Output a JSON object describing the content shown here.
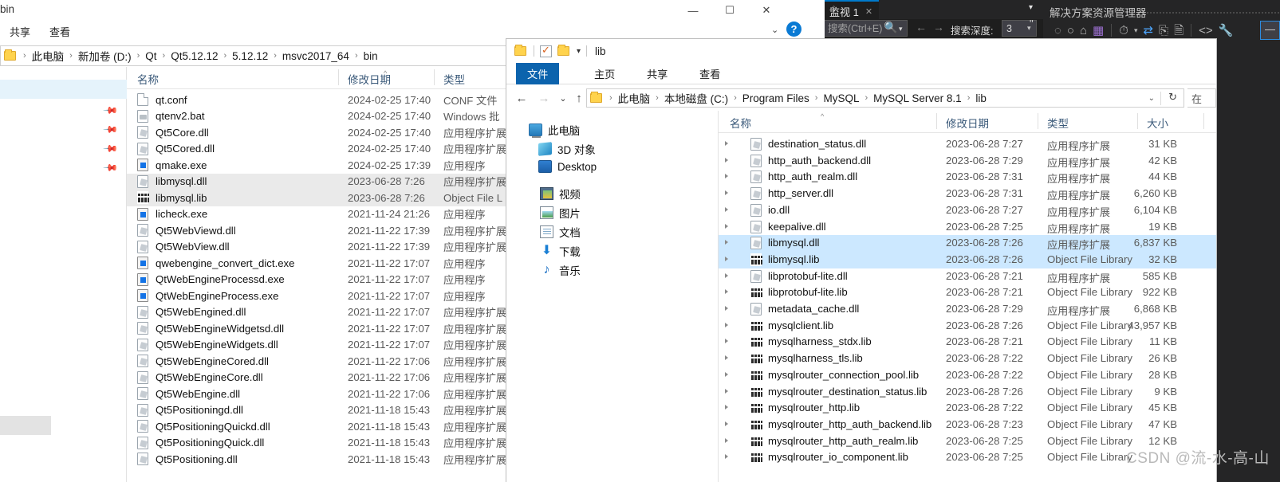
{
  "left_window": {
    "title": "bin",
    "ribbon_tabs": [
      "共享",
      "查看"
    ],
    "window_buttons": {
      "minimize": "—",
      "maximize": "☐",
      "close": "✕"
    },
    "help_label": "?",
    "address_caret": "⌄",
    "breadcrumb": [
      "此电脑",
      "新加卷 (D:)",
      "Qt",
      "Qt5.12.12",
      "5.12.12",
      "msvc2017_64",
      "bin"
    ],
    "columns": [
      "名称",
      "修改日期",
      "类型"
    ],
    "rows": [
      {
        "name": "qt.conf",
        "date": "2024-02-25 17:40",
        "type": "CONF 文件",
        "icon": "doc-icon",
        "selected": false
      },
      {
        "name": "qtenv2.bat",
        "date": "2024-02-25 17:40",
        "type": "Windows 批",
        "icon": "bat-icon",
        "selected": false
      },
      {
        "name": "Qt5Core.dll",
        "date": "2024-02-25 17:40",
        "type": "应用程序扩展",
        "icon": "dll-icon",
        "selected": false
      },
      {
        "name": "Qt5Cored.dll",
        "date": "2024-02-25 17:40",
        "type": "应用程序扩展",
        "icon": "dll-icon",
        "selected": false
      },
      {
        "name": "qmake.exe",
        "date": "2024-02-25 17:39",
        "type": "应用程序",
        "icon": "exe-icon",
        "selected": false
      },
      {
        "name": "libmysql.dll",
        "date": "2023-06-28 7:26",
        "type": "应用程序扩展",
        "icon": "dll-icon",
        "selected": true
      },
      {
        "name": "libmysql.lib",
        "date": "2023-06-28 7:26",
        "type": "Object File L",
        "icon": "lib-icon",
        "selected": true
      },
      {
        "name": "licheck.exe",
        "date": "2021-11-24 21:26",
        "type": "应用程序",
        "icon": "exe-icon",
        "selected": false
      },
      {
        "name": "Qt5WebViewd.dll",
        "date": "2021-11-22 17:39",
        "type": "应用程序扩展",
        "icon": "dll-icon",
        "selected": false
      },
      {
        "name": "Qt5WebView.dll",
        "date": "2021-11-22 17:39",
        "type": "应用程序扩展",
        "icon": "dll-icon",
        "selected": false
      },
      {
        "name": "qwebengine_convert_dict.exe",
        "date": "2021-11-22 17:07",
        "type": "应用程序",
        "icon": "exe-icon",
        "selected": false
      },
      {
        "name": "QtWebEngineProcessd.exe",
        "date": "2021-11-22 17:07",
        "type": "应用程序",
        "icon": "exe-icon",
        "selected": false
      },
      {
        "name": "QtWebEngineProcess.exe",
        "date": "2021-11-22 17:07",
        "type": "应用程序",
        "icon": "exe-icon",
        "selected": false
      },
      {
        "name": "Qt5WebEngined.dll",
        "date": "2021-11-22 17:07",
        "type": "应用程序扩展",
        "icon": "dll-icon",
        "selected": false
      },
      {
        "name": "Qt5WebEngineWidgetsd.dll",
        "date": "2021-11-22 17:07",
        "type": "应用程序扩展",
        "icon": "dll-icon",
        "selected": false
      },
      {
        "name": "Qt5WebEngineWidgets.dll",
        "date": "2021-11-22 17:07",
        "type": "应用程序扩展",
        "icon": "dll-icon",
        "selected": false
      },
      {
        "name": "Qt5WebEngineCored.dll",
        "date": "2021-11-22 17:06",
        "type": "应用程序扩展",
        "icon": "dll-icon",
        "selected": false
      },
      {
        "name": "Qt5WebEngineCore.dll",
        "date": "2021-11-22 17:06",
        "type": "应用程序扩展",
        "icon": "dll-icon",
        "selected": false
      },
      {
        "name": "Qt5WebEngine.dll",
        "date": "2021-11-22 17:06",
        "type": "应用程序扩展",
        "icon": "dll-icon",
        "selected": false
      },
      {
        "name": "Qt5Positioningd.dll",
        "date": "2021-11-18 15:43",
        "type": "应用程序扩展",
        "icon": "dll-icon",
        "selected": false
      },
      {
        "name": "Qt5PositioningQuickd.dll",
        "date": "2021-11-18 15:43",
        "type": "应用程序扩展",
        "icon": "dll-icon",
        "selected": false
      },
      {
        "name": "Qt5PositioningQuick.dll",
        "date": "2021-11-18 15:43",
        "type": "应用程序扩展",
        "icon": "dll-icon",
        "selected": false
      },
      {
        "name": "Qt5Positioning.dll",
        "date": "2021-11-18 15:43",
        "type": "应用程序扩展",
        "icon": "dll-icon",
        "selected": false
      }
    ]
  },
  "right_window": {
    "quick_access_title": "lib",
    "quick_access_caret": "▾",
    "ribbon_tabs": [
      "文件",
      "主页",
      "共享",
      "查看"
    ],
    "active_ribbon_tab": "文件",
    "nav_back": "←",
    "nav_forward": "→",
    "nav_recent": "⌄",
    "nav_up": "↑",
    "breadcrumb": [
      "此电脑",
      "本地磁盘 (C:)",
      "Program Files",
      "MySQL",
      "MySQL Server 8.1",
      "lib"
    ],
    "address_caret": "⌄",
    "refresh_icon": "↻",
    "search_placeholder": "在",
    "nav_items": [
      {
        "label": "此电脑",
        "icon": "computer-icon"
      },
      {
        "label": "3D 对象",
        "icon": "3d-objects-icon"
      },
      {
        "label": "Desktop",
        "icon": "desktop-icon"
      },
      {
        "label": "视频",
        "icon": "videos-icon"
      },
      {
        "label": "图片",
        "icon": "pictures-icon"
      },
      {
        "label": "文档",
        "icon": "documents-icon"
      },
      {
        "label": "下载",
        "icon": "downloads-icon"
      },
      {
        "label": "音乐",
        "icon": "music-icon"
      }
    ],
    "columns": [
      "名称",
      "修改日期",
      "类型",
      "大小"
    ],
    "rows": [
      {
        "name": "destination_status.dll",
        "date": "2023-06-28 7:27",
        "type": "应用程序扩展",
        "size": "31 KB",
        "icon": "dll-icon",
        "selected": false
      },
      {
        "name": "http_auth_backend.dll",
        "date": "2023-06-28 7:29",
        "type": "应用程序扩展",
        "size": "42 KB",
        "icon": "dll-icon",
        "selected": false
      },
      {
        "name": "http_auth_realm.dll",
        "date": "2023-06-28 7:31",
        "type": "应用程序扩展",
        "size": "44 KB",
        "icon": "dll-icon",
        "selected": false
      },
      {
        "name": "http_server.dll",
        "date": "2023-06-28 7:31",
        "type": "应用程序扩展",
        "size": "6,260 KB",
        "icon": "dll-icon",
        "selected": false
      },
      {
        "name": "io.dll",
        "date": "2023-06-28 7:27",
        "type": "应用程序扩展",
        "size": "6,104 KB",
        "icon": "dll-icon",
        "selected": false
      },
      {
        "name": "keepalive.dll",
        "date": "2023-06-28 7:25",
        "type": "应用程序扩展",
        "size": "19 KB",
        "icon": "dll-icon",
        "selected": false
      },
      {
        "name": "libmysql.dll",
        "date": "2023-06-28 7:26",
        "type": "应用程序扩展",
        "size": "6,837 KB",
        "icon": "dll-icon",
        "selected": true
      },
      {
        "name": "libmysql.lib",
        "date": "2023-06-28 7:26",
        "type": "Object File Library",
        "size": "32 KB",
        "icon": "lib-icon",
        "selected": true
      },
      {
        "name": "libprotobuf-lite.dll",
        "date": "2023-06-28 7:21",
        "type": "应用程序扩展",
        "size": "585 KB",
        "icon": "dll-icon",
        "selected": false
      },
      {
        "name": "libprotobuf-lite.lib",
        "date": "2023-06-28 7:21",
        "type": "Object File Library",
        "size": "922 KB",
        "icon": "lib-icon",
        "selected": false
      },
      {
        "name": "metadata_cache.dll",
        "date": "2023-06-28 7:29",
        "type": "应用程序扩展",
        "size": "6,868 KB",
        "icon": "dll-icon",
        "selected": false
      },
      {
        "name": "mysqlclient.lib",
        "date": "2023-06-28 7:26",
        "type": "Object File Library",
        "size": "43,957 KB",
        "icon": "lib-icon",
        "selected": false
      },
      {
        "name": "mysqlharness_stdx.lib",
        "date": "2023-06-28 7:21",
        "type": "Object File Library",
        "size": "11 KB",
        "icon": "lib-icon",
        "selected": false
      },
      {
        "name": "mysqlharness_tls.lib",
        "date": "2023-06-28 7:22",
        "type": "Object File Library",
        "size": "26 KB",
        "icon": "lib-icon",
        "selected": false
      },
      {
        "name": "mysqlrouter_connection_pool.lib",
        "date": "2023-06-28 7:22",
        "type": "Object File Library",
        "size": "28 KB",
        "icon": "lib-icon",
        "selected": false
      },
      {
        "name": "mysqlrouter_destination_status.lib",
        "date": "2023-06-28 7:26",
        "type": "Object File Library",
        "size": "9 KB",
        "icon": "lib-icon",
        "selected": false
      },
      {
        "name": "mysqlrouter_http.lib",
        "date": "2023-06-28 7:22",
        "type": "Object File Library",
        "size": "45 KB",
        "icon": "lib-icon",
        "selected": false
      },
      {
        "name": "mysqlrouter_http_auth_backend.lib",
        "date": "2023-06-28 7:23",
        "type": "Object File Library",
        "size": "47 KB",
        "icon": "lib-icon",
        "selected": false
      },
      {
        "name": "mysqlrouter_http_auth_realm.lib",
        "date": "2023-06-28 7:25",
        "type": "Object File Library",
        "size": "12 KB",
        "icon": "lib-icon",
        "selected": false
      },
      {
        "name": "mysqlrouter_io_component.lib",
        "date": "2023-06-28 7:25",
        "type": "Object File Library",
        "size": "",
        "icon": "lib-icon",
        "selected": false
      }
    ]
  },
  "visual_studio": {
    "gear_icon": "⚙",
    "watch_tab": {
      "label": "监视 1",
      "pin": "⇱",
      "close": "✕"
    },
    "tab_overflow_caret": "▾",
    "search_value": "搜索(Ctrl+E)",
    "search_icon": "search-icon",
    "search_dropdown_caret": "▾",
    "back_arrow": "←",
    "forward_arrow": "→",
    "depth_label": "搜索深度:",
    "depth_value": "3",
    "depth_caret": "▾",
    "quote_marks": "\"",
    "solution_explorer": {
      "title": "解决方案资源管理器",
      "toolbar_icons": [
        "back-icon",
        "forward-icon",
        "home-icon",
        "vs-project-icon",
        "pending-changes-icon",
        "toolbar-caret",
        "sync-icon",
        "collapse-all-icon",
        "properties-icon",
        "show-all-files-icon",
        "wrench-icon"
      ]
    },
    "accent_color": "#007acc"
  },
  "watermark": "CSDN @流-水-高-山"
}
